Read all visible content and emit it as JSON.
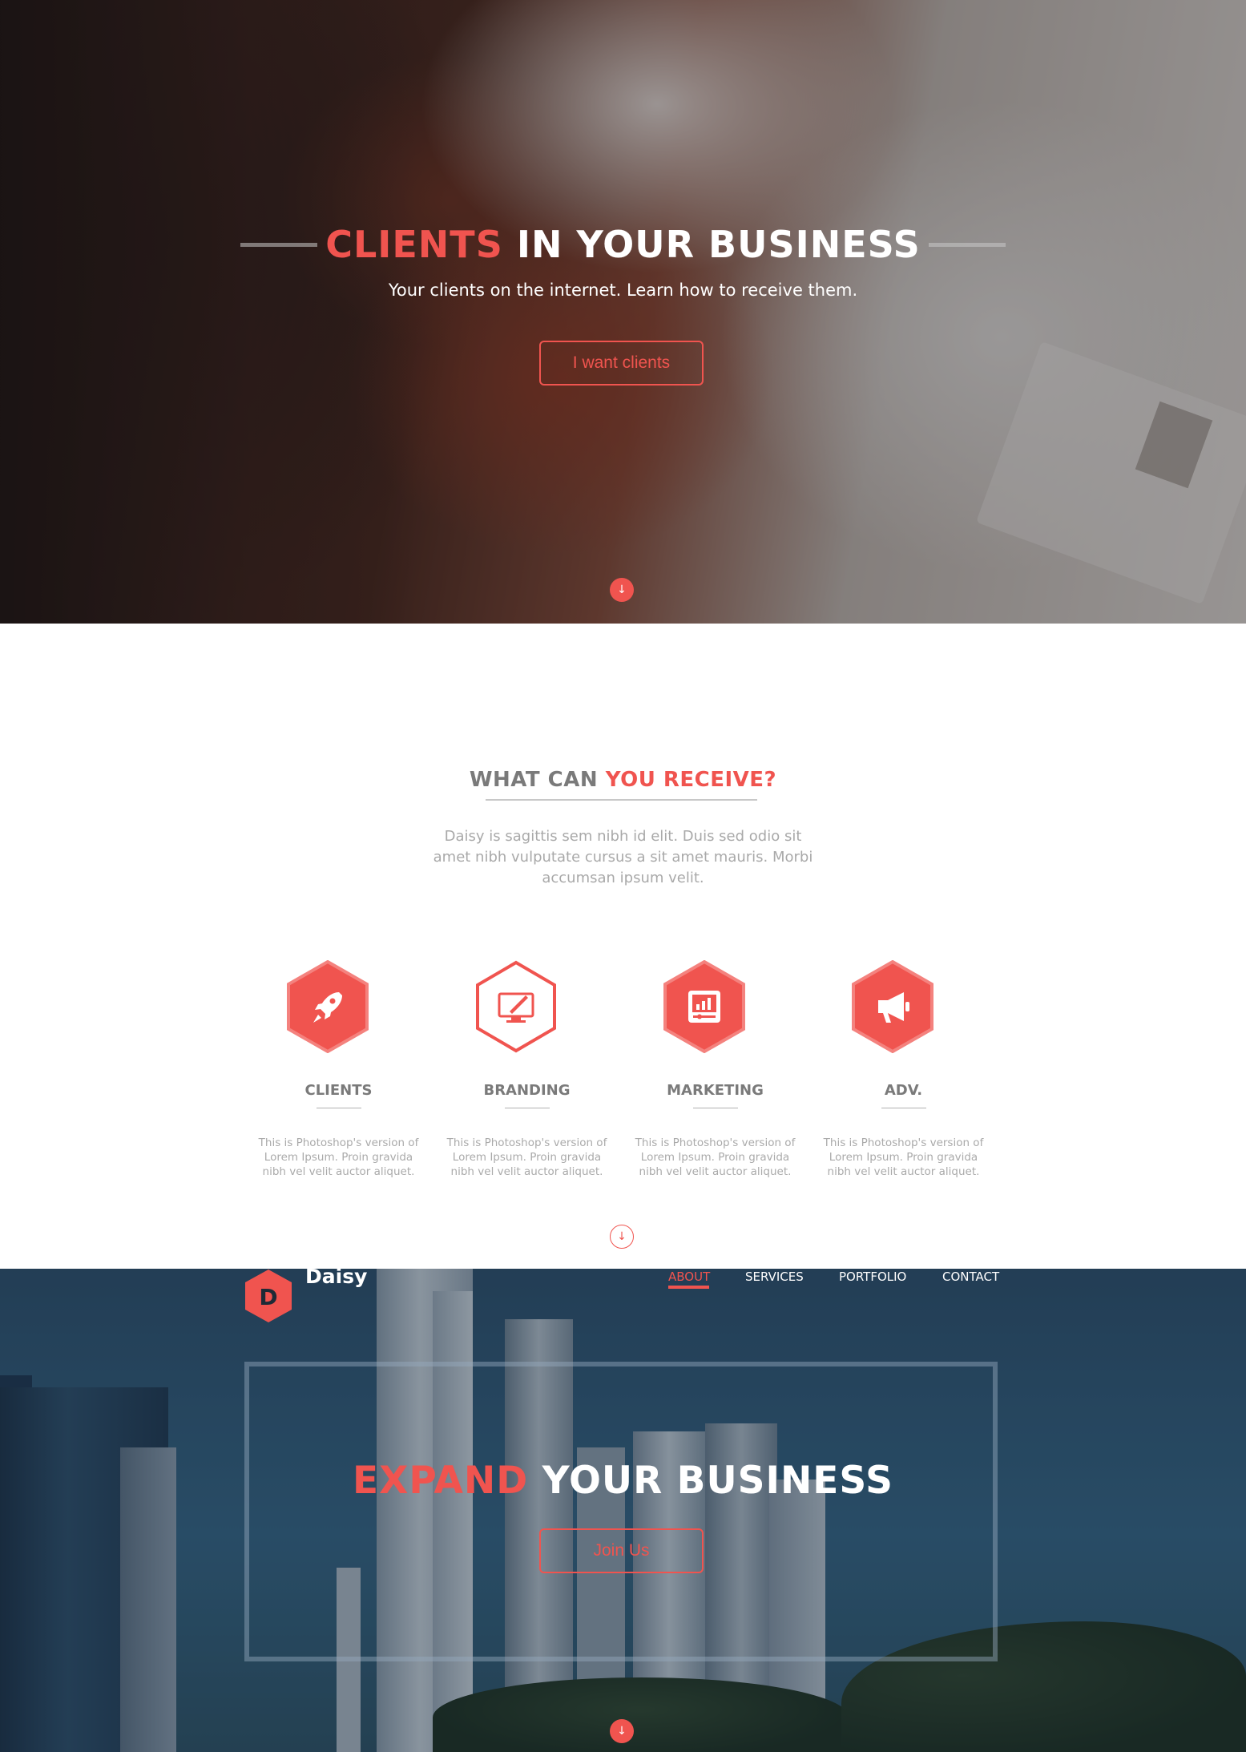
{
  "colors": {
    "accent": "#f0544f",
    "text_gray": "#7a7a7a",
    "muted": "#aaaaaa"
  },
  "hero": {
    "title_accent": "CLIENTS",
    "title_rest": "IN YOUR BUSINESS",
    "subtitle": "Your clients on the internet. Learn how to receive them.",
    "button_label": "I want clients",
    "scroll_icon": "↓"
  },
  "services": {
    "title_gray": "WHAT CAN",
    "title_accent": "YOU RECEIVE?",
    "description": "Daisy is sagittis sem nibh id elit. Duis sed odio sit amet nibh vulputate cursus a sit amet mauris. Morbi accumsan ipsum velit.",
    "items": [
      {
        "title": "CLIENTS",
        "icon": "rocket-icon",
        "description": "This is Photoshop's version of Lorem Ipsum. Proin gravida nibh vel velit auctor aliquet."
      },
      {
        "title": "BRANDING",
        "icon": "monitor-pen-icon",
        "description": "This is Photoshop's version of Lorem Ipsum. Proin gravida nibh vel velit auctor aliquet."
      },
      {
        "title": "MARKETING",
        "icon": "chart-icon",
        "description": "This is Photoshop's version of Lorem Ipsum. Proin gravida nibh vel velit auctor aliquet."
      },
      {
        "title": "ADV.",
        "icon": "megaphone-icon",
        "description": "This is Photoshop's version of Lorem Ipsum. Proin gravida nibh vel velit auctor aliquet."
      }
    ],
    "scroll_icon": "↓"
  },
  "city": {
    "logo_letter": "D",
    "logo_text": "Daisy",
    "nav": [
      "ABOUT",
      "SERVICES",
      "PORTFOLIO",
      "CONTACT"
    ],
    "nav_active": "ABOUT",
    "title_accent": "EXPAND",
    "title_rest": "YOUR BUSINESS",
    "button_label": "Join Us",
    "scroll_icon": "↓"
  }
}
